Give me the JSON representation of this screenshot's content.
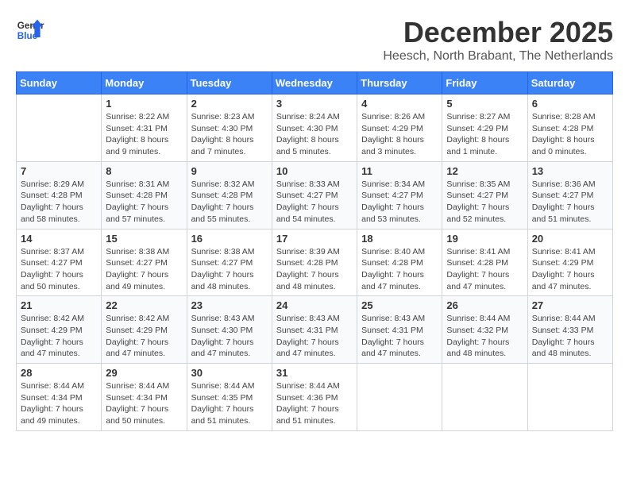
{
  "header": {
    "logo_general": "General",
    "logo_blue": "Blue",
    "month_title": "December 2025",
    "location": "Heesch, North Brabant, The Netherlands"
  },
  "days_of_week": [
    "Sunday",
    "Monday",
    "Tuesday",
    "Wednesday",
    "Thursday",
    "Friday",
    "Saturday"
  ],
  "weeks": [
    [
      {
        "day": "",
        "text": ""
      },
      {
        "day": "1",
        "text": "Sunrise: 8:22 AM\nSunset: 4:31 PM\nDaylight: 8 hours and 9 minutes."
      },
      {
        "day": "2",
        "text": "Sunrise: 8:23 AM\nSunset: 4:30 PM\nDaylight: 8 hours and 7 minutes."
      },
      {
        "day": "3",
        "text": "Sunrise: 8:24 AM\nSunset: 4:30 PM\nDaylight: 8 hours and 5 minutes."
      },
      {
        "day": "4",
        "text": "Sunrise: 8:26 AM\nSunset: 4:29 PM\nDaylight: 8 hours and 3 minutes."
      },
      {
        "day": "5",
        "text": "Sunrise: 8:27 AM\nSunset: 4:29 PM\nDaylight: 8 hours and 1 minute."
      },
      {
        "day": "6",
        "text": "Sunrise: 8:28 AM\nSunset: 4:28 PM\nDaylight: 8 hours and 0 minutes."
      }
    ],
    [
      {
        "day": "7",
        "text": "Sunrise: 8:29 AM\nSunset: 4:28 PM\nDaylight: 7 hours and 58 minutes."
      },
      {
        "day": "8",
        "text": "Sunrise: 8:31 AM\nSunset: 4:28 PM\nDaylight: 7 hours and 57 minutes."
      },
      {
        "day": "9",
        "text": "Sunrise: 8:32 AM\nSunset: 4:28 PM\nDaylight: 7 hours and 55 minutes."
      },
      {
        "day": "10",
        "text": "Sunrise: 8:33 AM\nSunset: 4:27 PM\nDaylight: 7 hours and 54 minutes."
      },
      {
        "day": "11",
        "text": "Sunrise: 8:34 AM\nSunset: 4:27 PM\nDaylight: 7 hours and 53 minutes."
      },
      {
        "day": "12",
        "text": "Sunrise: 8:35 AM\nSunset: 4:27 PM\nDaylight: 7 hours and 52 minutes."
      },
      {
        "day": "13",
        "text": "Sunrise: 8:36 AM\nSunset: 4:27 PM\nDaylight: 7 hours and 51 minutes."
      }
    ],
    [
      {
        "day": "14",
        "text": "Sunrise: 8:37 AM\nSunset: 4:27 PM\nDaylight: 7 hours and 50 minutes."
      },
      {
        "day": "15",
        "text": "Sunrise: 8:38 AM\nSunset: 4:27 PM\nDaylight: 7 hours and 49 minutes."
      },
      {
        "day": "16",
        "text": "Sunrise: 8:38 AM\nSunset: 4:27 PM\nDaylight: 7 hours and 48 minutes."
      },
      {
        "day": "17",
        "text": "Sunrise: 8:39 AM\nSunset: 4:28 PM\nDaylight: 7 hours and 48 minutes."
      },
      {
        "day": "18",
        "text": "Sunrise: 8:40 AM\nSunset: 4:28 PM\nDaylight: 7 hours and 47 minutes."
      },
      {
        "day": "19",
        "text": "Sunrise: 8:41 AM\nSunset: 4:28 PM\nDaylight: 7 hours and 47 minutes."
      },
      {
        "day": "20",
        "text": "Sunrise: 8:41 AM\nSunset: 4:29 PM\nDaylight: 7 hours and 47 minutes."
      }
    ],
    [
      {
        "day": "21",
        "text": "Sunrise: 8:42 AM\nSunset: 4:29 PM\nDaylight: 7 hours and 47 minutes."
      },
      {
        "day": "22",
        "text": "Sunrise: 8:42 AM\nSunset: 4:29 PM\nDaylight: 7 hours and 47 minutes."
      },
      {
        "day": "23",
        "text": "Sunrise: 8:43 AM\nSunset: 4:30 PM\nDaylight: 7 hours and 47 minutes."
      },
      {
        "day": "24",
        "text": "Sunrise: 8:43 AM\nSunset: 4:31 PM\nDaylight: 7 hours and 47 minutes."
      },
      {
        "day": "25",
        "text": "Sunrise: 8:43 AM\nSunset: 4:31 PM\nDaylight: 7 hours and 47 minutes."
      },
      {
        "day": "26",
        "text": "Sunrise: 8:44 AM\nSunset: 4:32 PM\nDaylight: 7 hours and 48 minutes."
      },
      {
        "day": "27",
        "text": "Sunrise: 8:44 AM\nSunset: 4:33 PM\nDaylight: 7 hours and 48 minutes."
      }
    ],
    [
      {
        "day": "28",
        "text": "Sunrise: 8:44 AM\nSunset: 4:34 PM\nDaylight: 7 hours and 49 minutes."
      },
      {
        "day": "29",
        "text": "Sunrise: 8:44 AM\nSunset: 4:34 PM\nDaylight: 7 hours and 50 minutes."
      },
      {
        "day": "30",
        "text": "Sunrise: 8:44 AM\nSunset: 4:35 PM\nDaylight: 7 hours and 51 minutes."
      },
      {
        "day": "31",
        "text": "Sunrise: 8:44 AM\nSunset: 4:36 PM\nDaylight: 7 hours and 51 minutes."
      },
      {
        "day": "",
        "text": ""
      },
      {
        "day": "",
        "text": ""
      },
      {
        "day": "",
        "text": ""
      }
    ]
  ]
}
